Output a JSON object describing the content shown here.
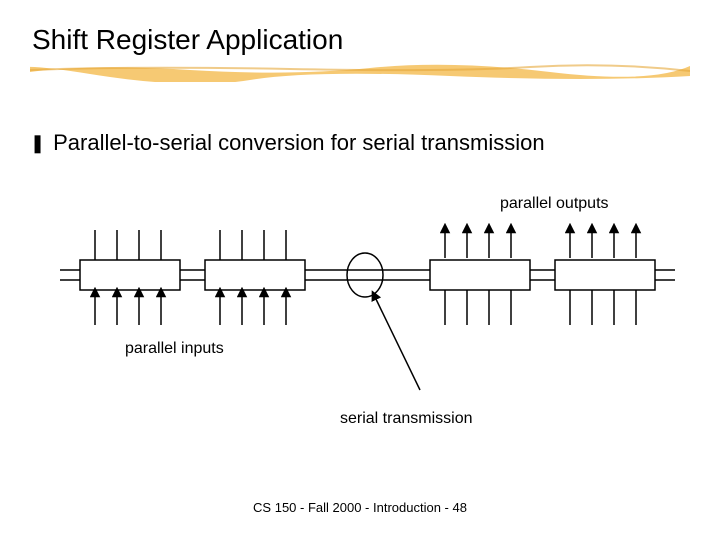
{
  "title": "Shift Register Application",
  "bullet": {
    "glyph": "❚",
    "text": "Parallel-to-serial conversion for serial transmission"
  },
  "labels": {
    "parallel_outputs": "parallel outputs",
    "parallel_inputs": "parallel inputs",
    "serial_transmission": "serial transmission"
  },
  "footer": "CS 150 - Fall 2000 - Introduction - 48"
}
